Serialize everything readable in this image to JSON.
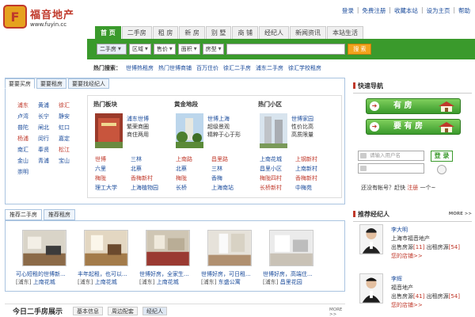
{
  "header": {
    "logo_char": "F",
    "site_name": "福音地产",
    "site_url": "www.fuyin.cc",
    "top_links": [
      "登录",
      "免费注册",
      "收藏本站",
      "设为主页",
      "帮助"
    ]
  },
  "nav": {
    "tabs": [
      "首 页",
      "二手房",
      "租 房",
      "新 房",
      "别 墅",
      "商 铺",
      "经纪人",
      "新闻资讯",
      "本站生活"
    ],
    "active_index": 0
  },
  "search": {
    "type_select": "二手房",
    "filters": [
      "区域",
      "售价",
      "面积",
      "房型"
    ],
    "button": "搜 索"
  },
  "hot_search": {
    "label": "热门搜索：",
    "items": [
      {
        "text": "世博热租房",
        "highlight": "热"
      },
      {
        "text": "热门世博商铺",
        "highlight": "热"
      },
      {
        "text": "百万住价",
        "highlight": ""
      },
      {
        "text": "徐汇二手房",
        "highlight": ""
      },
      {
        "text": "浦东二手房",
        "highlight": ""
      },
      {
        "text": "徐汇学校租房",
        "highlight": "学校"
      }
    ]
  },
  "main_tabs": [
    "要要买房",
    "要要租房",
    "要要找经纪人"
  ],
  "district_links": [
    {
      "t": "浦东",
      "red": true
    },
    {
      "t": "黄浦",
      "red": false
    },
    {
      "t": "徐汇",
      "red": true
    },
    {
      "t": "卢湾",
      "red": false
    },
    {
      "t": "长宁",
      "red": false
    },
    {
      "t": "静安",
      "red": false
    },
    {
      "t": "普陀",
      "red": false
    },
    {
      "t": "闸北",
      "red": false
    },
    {
      "t": "虹口",
      "red": false
    },
    {
      "t": "杨浦",
      "red": true
    },
    {
      "t": "闵行",
      "red": false
    },
    {
      "t": "嘉定",
      "red": false
    },
    {
      "t": "南汇",
      "red": false
    },
    {
      "t": "奉贤",
      "red": false
    },
    {
      "t": "松江",
      "red": true
    },
    {
      "t": "金山",
      "red": false
    },
    {
      "t": "青浦",
      "red": false
    },
    {
      "t": "宝山",
      "red": false
    },
    {
      "t": "崇明",
      "red": false
    }
  ],
  "blocks": [
    {
      "title": "热门板块",
      "side": [
        "浦东世博",
        "繁荣商圈",
        "商住两用"
      ],
      "grid": [
        {
          "t": "世博",
          "red": true
        },
        {
          "t": "三林",
          "red": false
        },
        {
          "t": "六里",
          "red": false
        },
        {
          "t": "北蔡",
          "red": false
        },
        {
          "t": "梅陇",
          "red": true
        },
        {
          "t": "香梅新村",
          "red": true
        },
        {
          "t": "理工大学",
          "red": false
        },
        {
          "t": "上海植物园",
          "red": false
        }
      ]
    },
    {
      "title": "黄金地段",
      "side": [
        "世博上海",
        "超级景观",
        "精粹于心于形"
      ],
      "grid": [
        {
          "t": "上南路",
          "red": true
        },
        {
          "t": "昌里路",
          "red": true
        },
        {
          "t": "北蔡",
          "red": false
        },
        {
          "t": "三林",
          "red": false
        },
        {
          "t": "梅陇",
          "red": true
        },
        {
          "t": "香梅",
          "red": false
        },
        {
          "t": "长桥",
          "red": false
        },
        {
          "t": "上海南站",
          "red": false
        }
      ]
    },
    {
      "title": "热门小区",
      "side": [
        "世博家园",
        "性价比高",
        "高质限量"
      ],
      "grid": [
        {
          "t": "上南花城",
          "red": false
        },
        {
          "t": "上钢新村",
          "red": true
        },
        {
          "t": "昌里小区",
          "red": false
        },
        {
          "t": "上南新村",
          "red": false
        },
        {
          "t": "梅陇四村",
          "red": true
        },
        {
          "t": "香梅新村",
          "red": true
        },
        {
          "t": "长桥新村",
          "red": true
        },
        {
          "t": "中梅苑",
          "red": false
        }
      ]
    }
  ],
  "right": {
    "quick_nav": "快速导航",
    "sell_btn": "有 房",
    "buy_btn": "要 有 房",
    "username_ph": "请输入用户名",
    "password_ph": "",
    "login_btn": "登 录",
    "reg_q": "还没有帐号？赶快",
    "reg_link": "注册",
    "reg_tail": "一个~"
  },
  "agents": {
    "title": "推荐经纪人",
    "more": "MORE >>",
    "list": [
      {
        "name": "李大明",
        "company": "上海市福音地产",
        "sell": "出售房源",
        "sell_n": "[11]",
        "rent": "出租房源",
        "rent_n": "[54]",
        "shop": "您的店铺>>"
      },
      {
        "name": "李辉",
        "company": "福音地产",
        "sell": "出售房源",
        "sell_n": "[41]",
        "rent": "出租房源",
        "rent_n": "[54]",
        "shop": "您的店铺>>"
      }
    ]
  },
  "rec_tabs": [
    "推荐二手房",
    "推荐租房"
  ],
  "rec_cards": [
    {
      "title": "可心短租的世博新...",
      "area": "[浦东]",
      "place": "上南花城"
    },
    {
      "title": "丰年起租，也可以...",
      "area": "[浦东]",
      "place": "上南花城"
    },
    {
      "title": "世博好房，全家生...",
      "area": "[浦东]",
      "place": "上南花城"
    },
    {
      "title": "世博好房，可日租...",
      "area": "[浦东]",
      "place": "东盛公寓"
    },
    {
      "title": "世博好房，高端住...",
      "area": "[浦东]",
      "place": "昌里花园"
    }
  ],
  "bottom": {
    "title": "今日二手房展示",
    "tabs": [
      "基本信息",
      "周边配套",
      "经纪人"
    ],
    "more": "MORE >>"
  },
  "colors": {
    "green": "#3a9a2c",
    "red": "#c0392b",
    "link": "#1a4b9b",
    "orange": "#f2a31c"
  }
}
